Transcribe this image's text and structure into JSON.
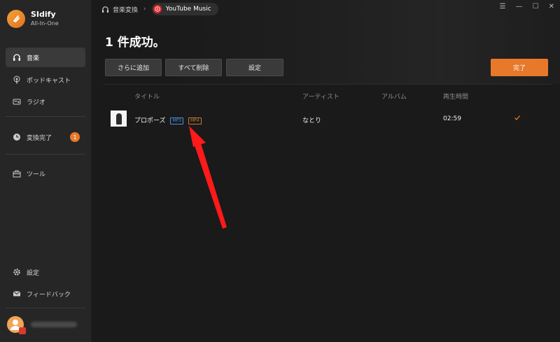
{
  "app": {
    "name": "SIdify",
    "subtitle": "All-In-One"
  },
  "sidebar": {
    "items": [
      {
        "label": "音楽"
      },
      {
        "label": "ポッドキャスト"
      },
      {
        "label": "ラジオ"
      },
      {
        "label": "変換完了",
        "badge": "1"
      },
      {
        "label": "ツール"
      },
      {
        "label": "設定"
      },
      {
        "label": "フィードバック"
      }
    ]
  },
  "breadcrumb": {
    "parent": "音楽変換",
    "current": "YouTube Music"
  },
  "main": {
    "title": "1 件成功。",
    "toolbar": {
      "add_more": "さらに追加",
      "delete_all": "すべて削除",
      "settings": "設定",
      "done": "完了"
    },
    "table": {
      "headers": {
        "title": "タイトル",
        "artist": "アーティスト",
        "album": "アルバム",
        "duration": "再生時間"
      },
      "rows": [
        {
          "title": "プロポーズ",
          "tags": [
            "MP3",
            "MP4"
          ],
          "artist": "なとり",
          "album": "",
          "duration": "02:59",
          "status": "done"
        }
      ]
    }
  },
  "colors": {
    "accent": "#e8782a",
    "youtube": "#e0282c",
    "annotation_arrow": "#ff1a1a"
  },
  "icons": [
    "headphones-icon",
    "podcast-icon",
    "radio-icon",
    "clock-icon",
    "toolbox-icon",
    "gear-icon",
    "mail-icon",
    "check-icon",
    "menu-icon",
    "minimize-icon",
    "maximize-icon",
    "close-icon"
  ]
}
